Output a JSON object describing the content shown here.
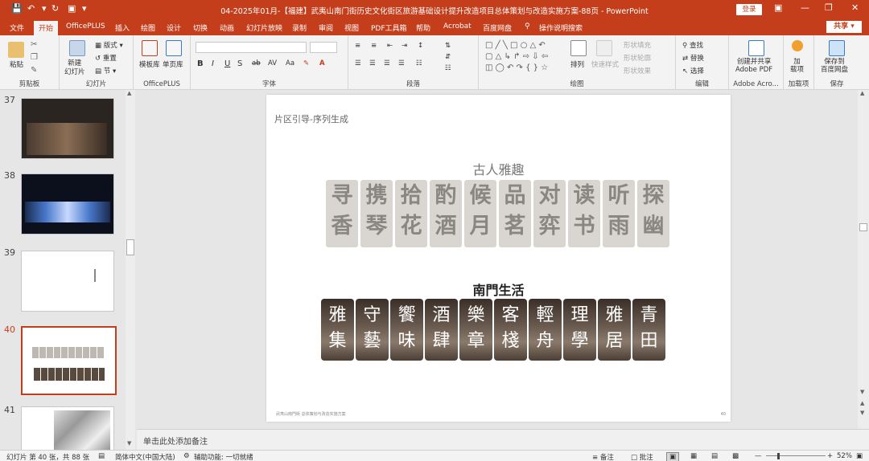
{
  "window": {
    "title": "04-2025年01月-【福建】武夷山南门街历史文化街区旅游基础设计提升改造项目总体策划与改造实施方案-88页  -  PowerPoint",
    "login_label": "登录"
  },
  "tabs": [
    "文件",
    "开始",
    "OfficePLUS",
    "插入",
    "绘图",
    "设计",
    "切换",
    "动画",
    "幻灯片放映",
    "录制",
    "审阅",
    "视图",
    "PDF工具箱",
    "帮助",
    "Acrobat",
    "百度网盘"
  ],
  "tell_me": "操作说明搜索",
  "share_label": "共享",
  "ribbon": {
    "clipboard": {
      "paste": "粘贴",
      "label": "剪贴板"
    },
    "slides": {
      "new_slide": "新建\n幻灯片",
      "layout": "版式",
      "reset": "重置",
      "section": "节",
      "label": "幻灯片"
    },
    "officeplus": {
      "template": "模板库",
      "single_page": "单页库",
      "label": "OfficePLUS"
    },
    "font": {
      "label": "字体"
    },
    "paragraph": {
      "label": "段落"
    },
    "drawing": {
      "arrange": "排列",
      "quick_styles": "快速样式",
      "fill": "形状填充",
      "outline": "形状轮廓",
      "effects": "形状效果",
      "label": "绘图"
    },
    "editing": {
      "find": "查找",
      "replace": "替换",
      "select": "选择",
      "label": "编辑"
    },
    "adobe": {
      "create": "创建并共享\nAdobe PDF",
      "label": "Adobe Acro..."
    },
    "addins": {
      "addin": "加\n载项",
      "label": "加载项"
    },
    "save": {
      "save_baidu": "保存到\n百度网盘",
      "label": "保存"
    }
  },
  "thumbnails": [
    {
      "num": "37",
      "selected": false
    },
    {
      "num": "38",
      "selected": false
    },
    {
      "num": "39",
      "selected": false
    },
    {
      "num": "40",
      "selected": true
    },
    {
      "num": "41",
      "selected": false
    }
  ],
  "slide": {
    "section_title": "片区引导-序列生成",
    "heading_top": "古人雅趣",
    "tiles_top": [
      [
        "寻",
        "香"
      ],
      [
        "携",
        "琴"
      ],
      [
        "拾",
        "花"
      ],
      [
        "酌",
        "酒"
      ],
      [
        "候",
        "月"
      ],
      [
        "品",
        "茗"
      ],
      [
        "对",
        "弈"
      ],
      [
        "读",
        "书"
      ],
      [
        "听",
        "雨"
      ],
      [
        "探",
        "幽"
      ]
    ],
    "heading_bottom": "南門生活",
    "tiles_bottom": [
      [
        "雅",
        "集"
      ],
      [
        "守",
        "藝"
      ],
      [
        "饗",
        "味"
      ],
      [
        "酒",
        "肆"
      ],
      [
        "樂",
        "章"
      ],
      [
        "客",
        "棧"
      ],
      [
        "輕",
        "舟"
      ],
      [
        "理",
        "學"
      ],
      [
        "雅",
        "居"
      ],
      [
        "青",
        "田"
      ]
    ],
    "footer": "武夷山南門街 总体策划与改造实施方案",
    "page_number": "40"
  },
  "notes_placeholder": "单击此处添加备注",
  "status": {
    "slide_info": "幻灯片 第 40 张，共 88 张",
    "language": "简体中文(中国大陆)",
    "accessibility": "辅助功能: 一切就绪",
    "notes_btn": "备注",
    "comments_btn": "批注",
    "zoom": "52%"
  },
  "colors": {
    "accent": "#c43e1c",
    "tile_light": "#d9d6d1",
    "tile_dark": "#3a2f28"
  }
}
